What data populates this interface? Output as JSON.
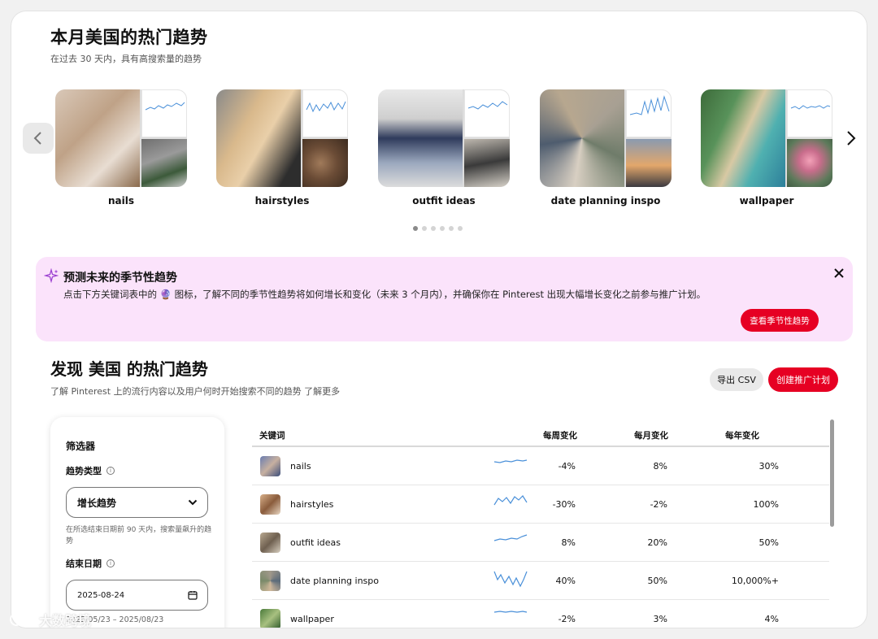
{
  "trends_section": {
    "title": "本月美国的热门趋势",
    "subtitle": "在过去 30 天内，具有高搜索量的趋势",
    "cards": [
      {
        "label": "nails"
      },
      {
        "label": "hairstyles"
      },
      {
        "label": "outfit ideas"
      },
      {
        "label": "date planning inspo"
      },
      {
        "label": "wallpaper"
      }
    ],
    "pagination_dots": 6,
    "active_dot": 0
  },
  "banner": {
    "title": "预测未来的季节性趋势",
    "description": "点击下方关键词表中的 🔮 图标，了解不同的季节性趋势将如何增长和变化（未来 3 个月内），并确保你在 Pinterest 出现大幅增长变化之前参与推广计划。",
    "button": "查看季节性趋势",
    "icon": "sparkle-icon",
    "close_icon": "close-icon"
  },
  "discover": {
    "title": "发现 美国 的热门趋势",
    "subtitle": "了解 Pinterest 上的流行内容以及用户何时开始搜索不同的趋势",
    "learn_more": "了解更多",
    "export_button": "导出 CSV",
    "create_button": "创建推广计划"
  },
  "filter": {
    "title": "筛选器",
    "trend_type_label": "趋势类型",
    "trend_type_value": "增长趋势",
    "trend_type_hint": "在所选结束日期前 90 天内，搜索量飙升的趋势",
    "end_date_label": "结束日期",
    "end_date_value": "2025-08-24",
    "date_range": "2025/05/23 – 2025/08/23"
  },
  "table": {
    "headers": {
      "keyword": "关键词",
      "weekly": "每周变化",
      "monthly": "每月变化",
      "yearly": "每年变化"
    },
    "rows": [
      {
        "keyword": "nails",
        "weekly": "-4%",
        "monthly": "8%",
        "yearly": "30%"
      },
      {
        "keyword": "hairstyles",
        "weekly": "-30%",
        "monthly": "-2%",
        "yearly": "100%"
      },
      {
        "keyword": "outfit ideas",
        "weekly": "8%",
        "monthly": "20%",
        "yearly": "50%"
      },
      {
        "keyword": "date planning inspo",
        "weekly": "40%",
        "monthly": "50%",
        "yearly": "10,000%+"
      },
      {
        "keyword": "wallpaper",
        "weekly": "-2%",
        "monthly": "3%",
        "yearly": "4%"
      }
    ]
  },
  "watermark": "大数跨境",
  "colors": {
    "accent": "#e60023",
    "banner_bg": "#fbe3fb",
    "sparkline": "#4a90d9"
  }
}
